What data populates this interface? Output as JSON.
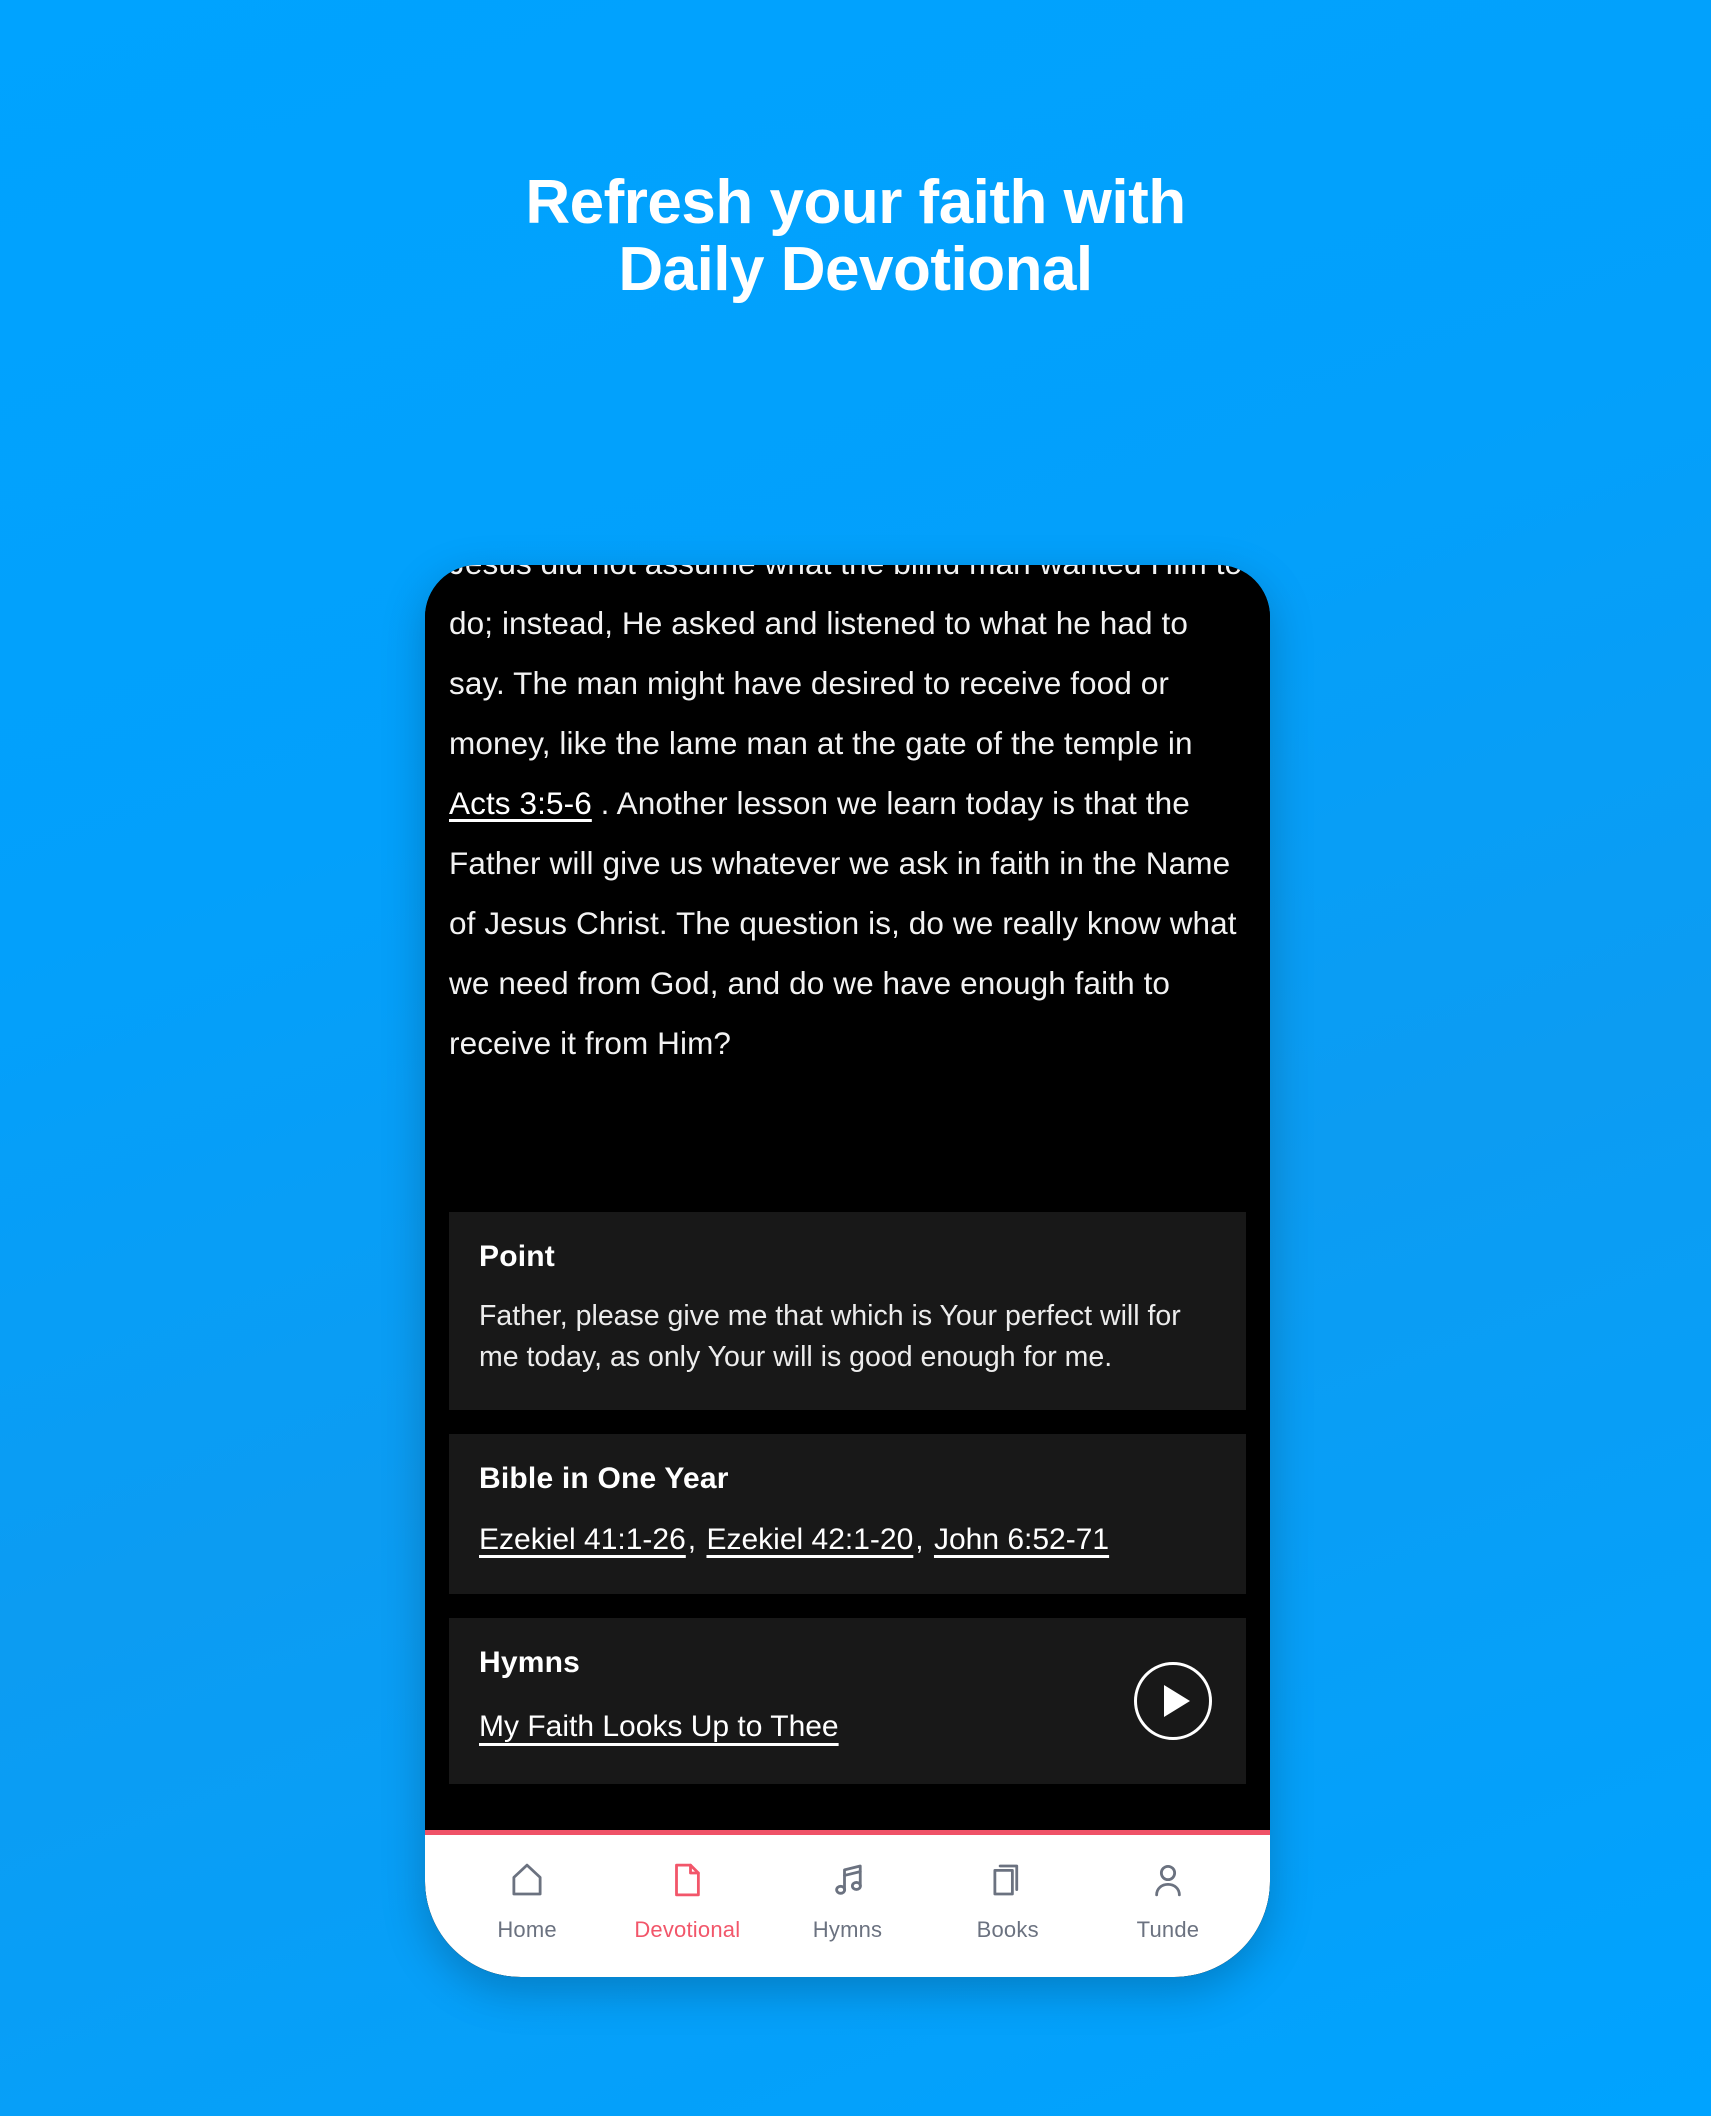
{
  "promo": {
    "headline_line1": "Refresh your faith with",
    "headline_line2": "Daily Devotional",
    "background_color": "#00A3FF",
    "accent_color": "#F2566A"
  },
  "devotional": {
    "body_part1": "Jesus did not assume what the blind man wanted Him to do; instead, He asked and listened to what he had to say. The man might have desired to receive food or money, like the lame man at the gate of the temple in ",
    "scripture_link": "Acts 3:5-6",
    "body_part2": " . Another lesson we learn today is that the Father will give us whatever we ask in faith in the Name of Jesus Christ. The question is, do we really know what we need from God, and do we have enough faith to receive it from Him?"
  },
  "point_card": {
    "title": "Point",
    "text": "Father, please give me that which is Your perfect will for me today, as only Your will is good enough for me."
  },
  "bible_card": {
    "title": "Bible in One Year",
    "readings": [
      "Ezekiel 41:1-26",
      "Ezekiel 42:1-20",
      "John 6:52-71"
    ],
    "separator": ","
  },
  "hymns_card": {
    "title": "Hymns",
    "hymn_title": "My Faith Looks Up to Thee",
    "play_icon": "play-icon"
  },
  "bottom_nav": {
    "items": [
      {
        "label": "Home",
        "icon": "home-icon",
        "active": false
      },
      {
        "label": "Devotional",
        "icon": "document-icon",
        "active": true
      },
      {
        "label": "Hymns",
        "icon": "music-note-icon",
        "active": false
      },
      {
        "label": "Books",
        "icon": "books-icon",
        "active": false
      },
      {
        "label": "Tunde",
        "icon": "person-icon",
        "active": false
      }
    ]
  }
}
